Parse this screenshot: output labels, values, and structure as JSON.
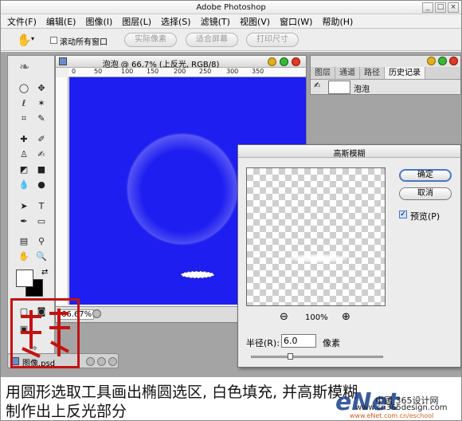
{
  "window": {
    "title": "Adobe Photoshop",
    "minimize": "_",
    "maximize": "□",
    "close": "×"
  },
  "menu": [
    "文件(F)",
    "编辑(E)",
    "图像(I)",
    "图层(L)",
    "选择(S)",
    "滤镜(T)",
    "视图(V)",
    "窗口(W)",
    "帮助(H)"
  ],
  "options": {
    "hand_icon": "hand-icon",
    "scroll_all": "滚动所有窗口",
    "actual_pixels": "实际像素",
    "fit_screen": "适合屏幕",
    "print_size": "打印尺寸"
  },
  "document": {
    "title": "泡泡 @ 66.7% (上反光, RGB/8)",
    "zoom": "66.67%",
    "canvas_color": "#1e1ef0",
    "ruler_labels": [
      "0",
      "50",
      "100",
      "150",
      "200",
      "250",
      "300",
      "350"
    ]
  },
  "dialog": {
    "title": "高斯模糊",
    "ok": "确定",
    "cancel": "取消",
    "preview_label": "预览(P)",
    "preview_checked": true,
    "zoom_percent": "100%",
    "zoom_out": "⊖",
    "zoom_in": "⊕",
    "radius_label": "半径(R):",
    "radius_value": "6.0",
    "unit": "像素",
    "slider_fraction": 0.28
  },
  "panel": {
    "tabs": [
      "图层",
      "通道",
      "路径",
      "历史记录"
    ],
    "history_item": "泡泡"
  },
  "taskbar_doc": "图像.psd",
  "caption": {
    "line1": "用圆形选取工具画出椭圆选区, 白色填充, 并高斯模糊",
    "line2": "制作出上反光部分"
  },
  "watermark": {
    "logo_text": "eNet",
    "chinese": "中国.365设计网",
    "url": "www.cn365design.com",
    "url2": "www.eNet.com.cn/eschool"
  }
}
